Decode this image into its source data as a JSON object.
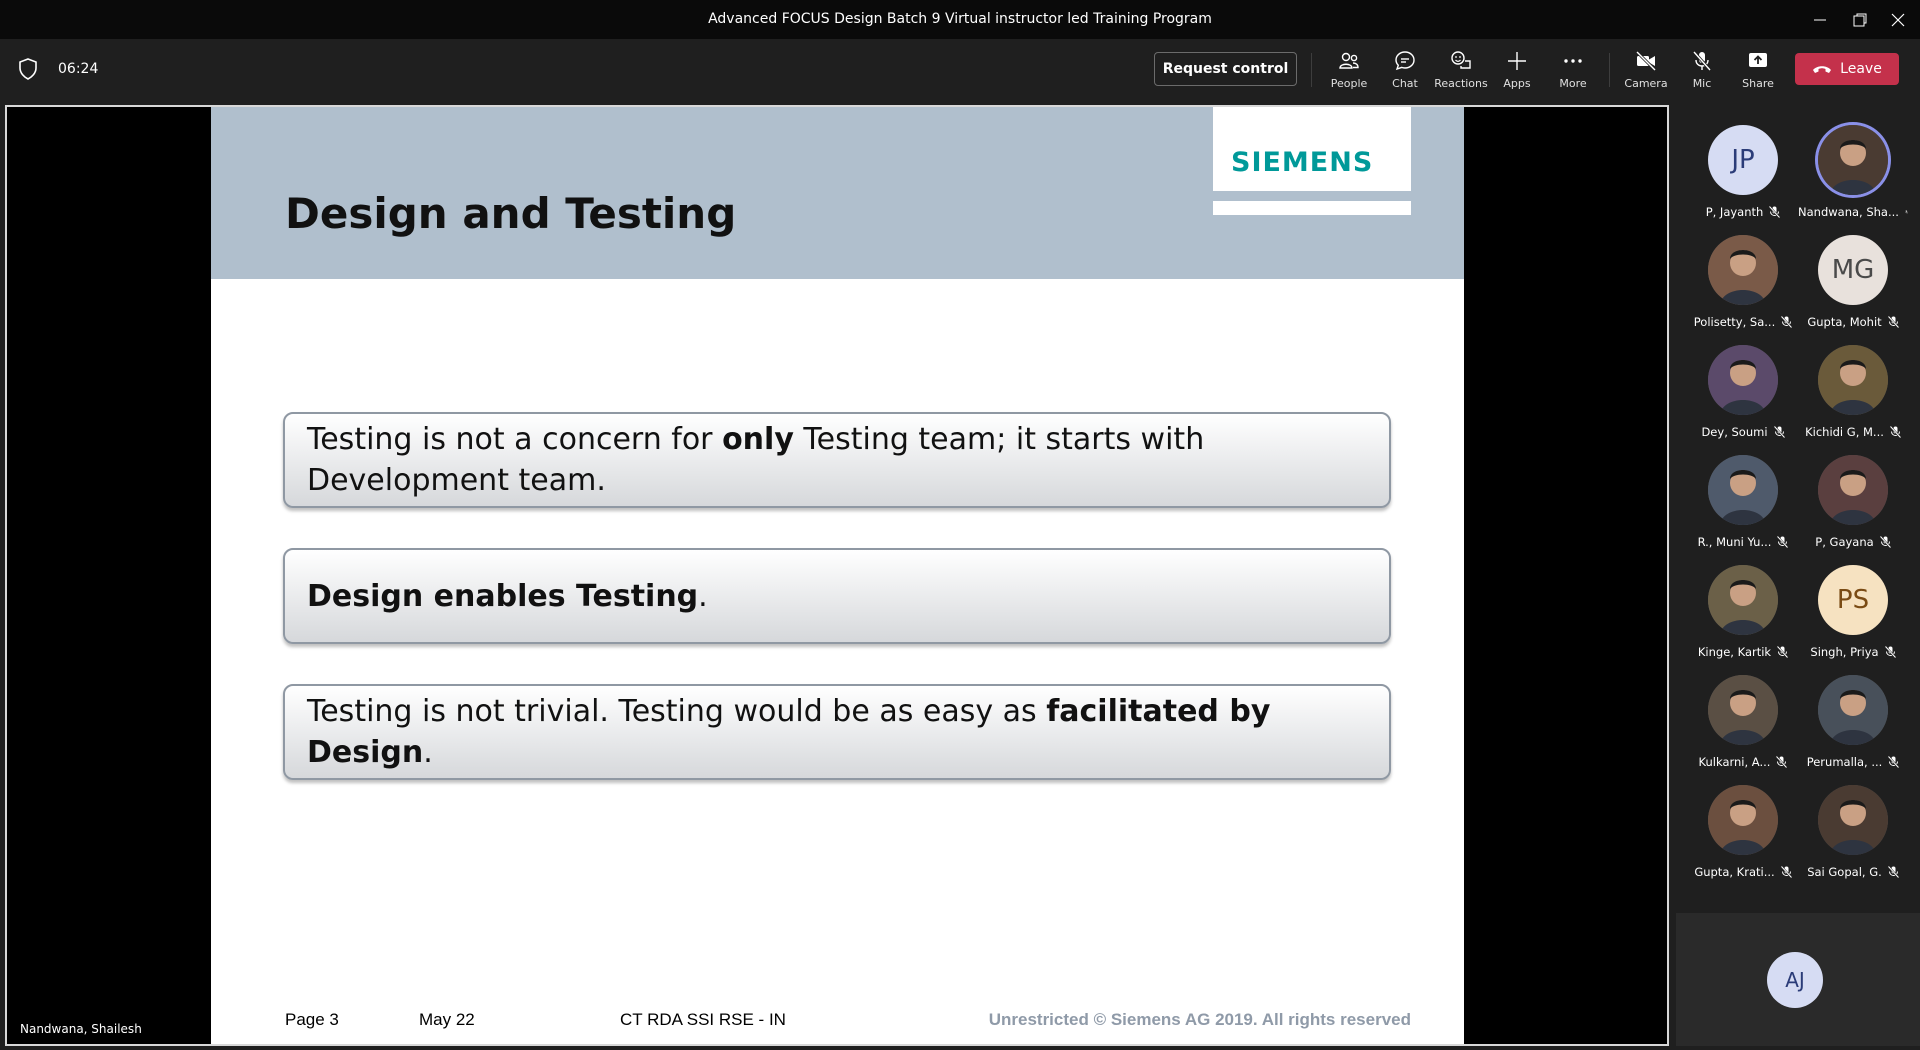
{
  "window": {
    "title": "Advanced FOCUS Design Batch 9 Virtual instructor led Training Program"
  },
  "toolbar": {
    "timer": "06:24",
    "request_control": "Request control",
    "buttons": {
      "people": "People",
      "chat": "Chat",
      "reactions": "Reactions",
      "apps": "Apps",
      "more": "More",
      "camera": "Camera",
      "mic": "Mic",
      "share": "Share"
    },
    "leave": "Leave"
  },
  "stage": {
    "presenter_name": "Nandwana, Shailesh"
  },
  "slide": {
    "logo": "SIEMENS",
    "title": "Design and Testing",
    "box1": {
      "pre": "Testing is not a concern for ",
      "bold": "only",
      "post": " Testing team; it starts with Development team."
    },
    "box2": {
      "bold": "Design enables Testing",
      "post": "."
    },
    "box3": {
      "pre": "Testing is not trivial. Testing would be as easy as ",
      "bold": "facilitated by Design",
      "post": "."
    },
    "footer": {
      "page": "Page 3",
      "date": "May 22",
      "dept": "CT RDA SSI RSE - IN",
      "rights": "Unrestricted © Siemens AG 2019. All rights reserved"
    }
  },
  "participants": [
    {
      "name": "P, Jayanth",
      "initials": "JP",
      "style": "init-blue"
    },
    {
      "name": "Nandwana, Sha...",
      "initials": "",
      "style": "photo"
    },
    {
      "name": "Polisetty, Sa...",
      "initials": "",
      "style": "photo"
    },
    {
      "name": "Gupta, Mohit",
      "initials": "MG",
      "style": "init-grey"
    },
    {
      "name": "Dey, Soumi",
      "initials": "",
      "style": "photo"
    },
    {
      "name": "Kichidi G, M...",
      "initials": "",
      "style": "photo"
    },
    {
      "name": "R., Muni Yu...",
      "initials": "",
      "style": "photo"
    },
    {
      "name": "P, Gayana",
      "initials": "",
      "style": "photo"
    },
    {
      "name": "Kinge, Kartik",
      "initials": "",
      "style": "photo"
    },
    {
      "name": "Singh, Priya",
      "initials": "PS",
      "style": "init-peach"
    },
    {
      "name": "Kulkarni, A...",
      "initials": "",
      "style": "photo"
    },
    {
      "name": "Perumalla, ...",
      "initials": "",
      "style": "photo"
    },
    {
      "name": "Gupta, Krati...",
      "initials": "",
      "style": "photo"
    },
    {
      "name": "Sai Gopal, G.",
      "initials": "",
      "style": "photo"
    }
  ],
  "self": {
    "initials": "AJ"
  },
  "colors": {
    "leave": "#c4314b",
    "siemens": "#009999",
    "slide_header": "#b0bfcd"
  }
}
